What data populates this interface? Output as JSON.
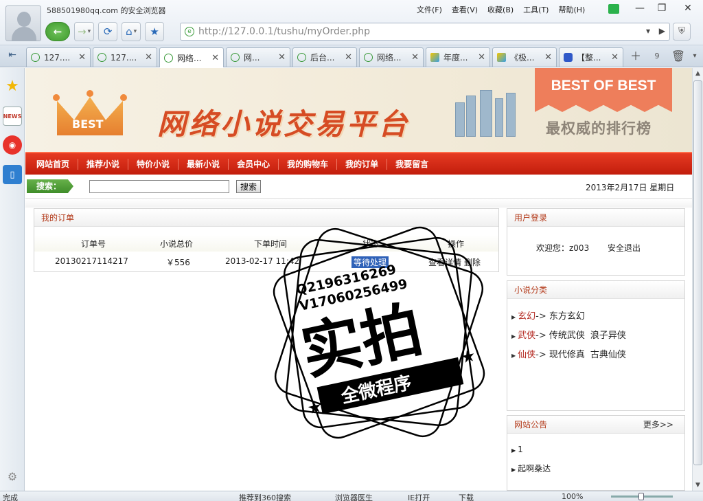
{
  "browser": {
    "account": "588501980qq.com 的安全浏览器",
    "menus": [
      "文件(F)",
      "查看(V)",
      "收藏(B)",
      "工具(T)",
      "帮助(H)"
    ],
    "url": "http://127.0.0.1/tushu/myOrder.php",
    "tabs": [
      {
        "label": "127....",
        "icon": "page-icon"
      },
      {
        "label": "127....",
        "icon": "page-icon"
      },
      {
        "label": "网络...",
        "icon": "page-icon",
        "active": true
      },
      {
        "label": "网...",
        "icon": "page-icon"
      },
      {
        "label": "后台...",
        "icon": "page-icon"
      },
      {
        "label": "网络...",
        "icon": "page-icon"
      },
      {
        "label": "年度...",
        "icon": "ie-icon"
      },
      {
        "label": "《极...",
        "icon": "ie-icon"
      },
      {
        "label": "【整...",
        "icon": "paw-icon"
      }
    ],
    "tab_counter": "9",
    "status": {
      "left": "完成",
      "recommend": "推荐到360搜索",
      "doctor": "浏览器医生",
      "ie_open": "IE打开",
      "download": "下载",
      "zoom": "100%"
    }
  },
  "site": {
    "crown_text": "BEST",
    "title": "网络小说交易平台",
    "ribbon": "BEST OF BEST",
    "slogan": "最权威的排行榜",
    "nav": [
      "网站首页",
      "推荐小说",
      "特价小说",
      "最新小说",
      "会员中心",
      "我的购物车",
      "我的订单",
      "我要留言"
    ],
    "search": {
      "label": "搜索：",
      "value": "",
      "button": "搜索"
    },
    "date": "2013年2月17日 星期日"
  },
  "orders": {
    "title": "我的订单",
    "columns": [
      "订单号",
      "小说总价",
      "下单时间",
      "状态",
      "操作"
    ],
    "rows": [
      {
        "id": "20130217114217",
        "total": "￥556",
        "time": "2013-02-17 11:42",
        "status": "等待处理",
        "view": "查看详情",
        "delete": "删除"
      }
    ]
  },
  "login": {
    "title": "用户登录",
    "welcome": "欢迎您：z003",
    "logout": "安全退出"
  },
  "categories": {
    "title": "小说分类",
    "items": [
      {
        "name": "玄幻",
        "subs": [
          "东方玄幻"
        ]
      },
      {
        "name": "武侠",
        "subs": [
          "传统武侠",
          "浪子异侠"
        ]
      },
      {
        "name": "仙侠",
        "subs": [
          "现代修真",
          "古典仙侠"
        ]
      }
    ]
  },
  "notice": {
    "title": "网站公告",
    "more": "更多>>",
    "items": [
      "1",
      "起啊桑达"
    ]
  },
  "watermark": {
    "contact1": "Q2196316269",
    "contact2": "V17060256499",
    "big": "实拍",
    "small": "全微程序"
  }
}
